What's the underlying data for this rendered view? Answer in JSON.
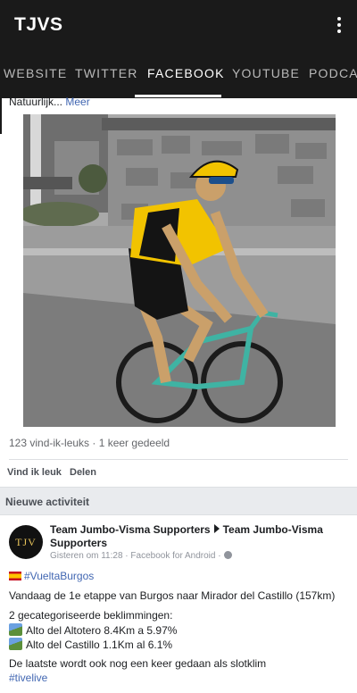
{
  "app": {
    "title": "TJVS",
    "tabs": [
      {
        "label": "WEBSITE",
        "active": false
      },
      {
        "label": "TWITTER",
        "active": false
      },
      {
        "label": "FACEBOOK",
        "active": true
      },
      {
        "label": "YOUTUBE",
        "active": false
      },
      {
        "label": "PODCAS",
        "active": false
      }
    ],
    "menu_icon": "more-vertical-icon",
    "colors": {
      "bar": "#1a1a1a",
      "link": "#4267b2",
      "muted": "#65676b"
    }
  },
  "post": {
    "snippet_text": "Natuurlijk...",
    "more_label": "Meer",
    "stats": "123 vind-ik-leuks · 1 keer gedeeld",
    "like_label": "Vind ik leuk",
    "share_label": "Delen"
  },
  "activity": {
    "section_title": "Nieuwe activiteit",
    "avatar_text": "TJV",
    "page_name": "Team Jumbo-Visma Supporters",
    "page_target": "Team Jumbo-Visma Supporters",
    "meta": "Gisteren om 11:28 · Facebook for Android ·",
    "hashtag": "#VueltaBurgos",
    "line1": "Vandaag de 1e etappe van Burgos naar Mirador del Castillo (157km)",
    "line2": "2 gecategoriseerde beklimmingen:",
    "climb1": "Alto del Altotero 8.4Km a 5.97%",
    "climb2": "Alto del Castillo 1.1Km al 6.1%",
    "line3": "De laatste wordt ook nog een keer gedaan als slotklim",
    "hashtag2": "#tivelive"
  }
}
